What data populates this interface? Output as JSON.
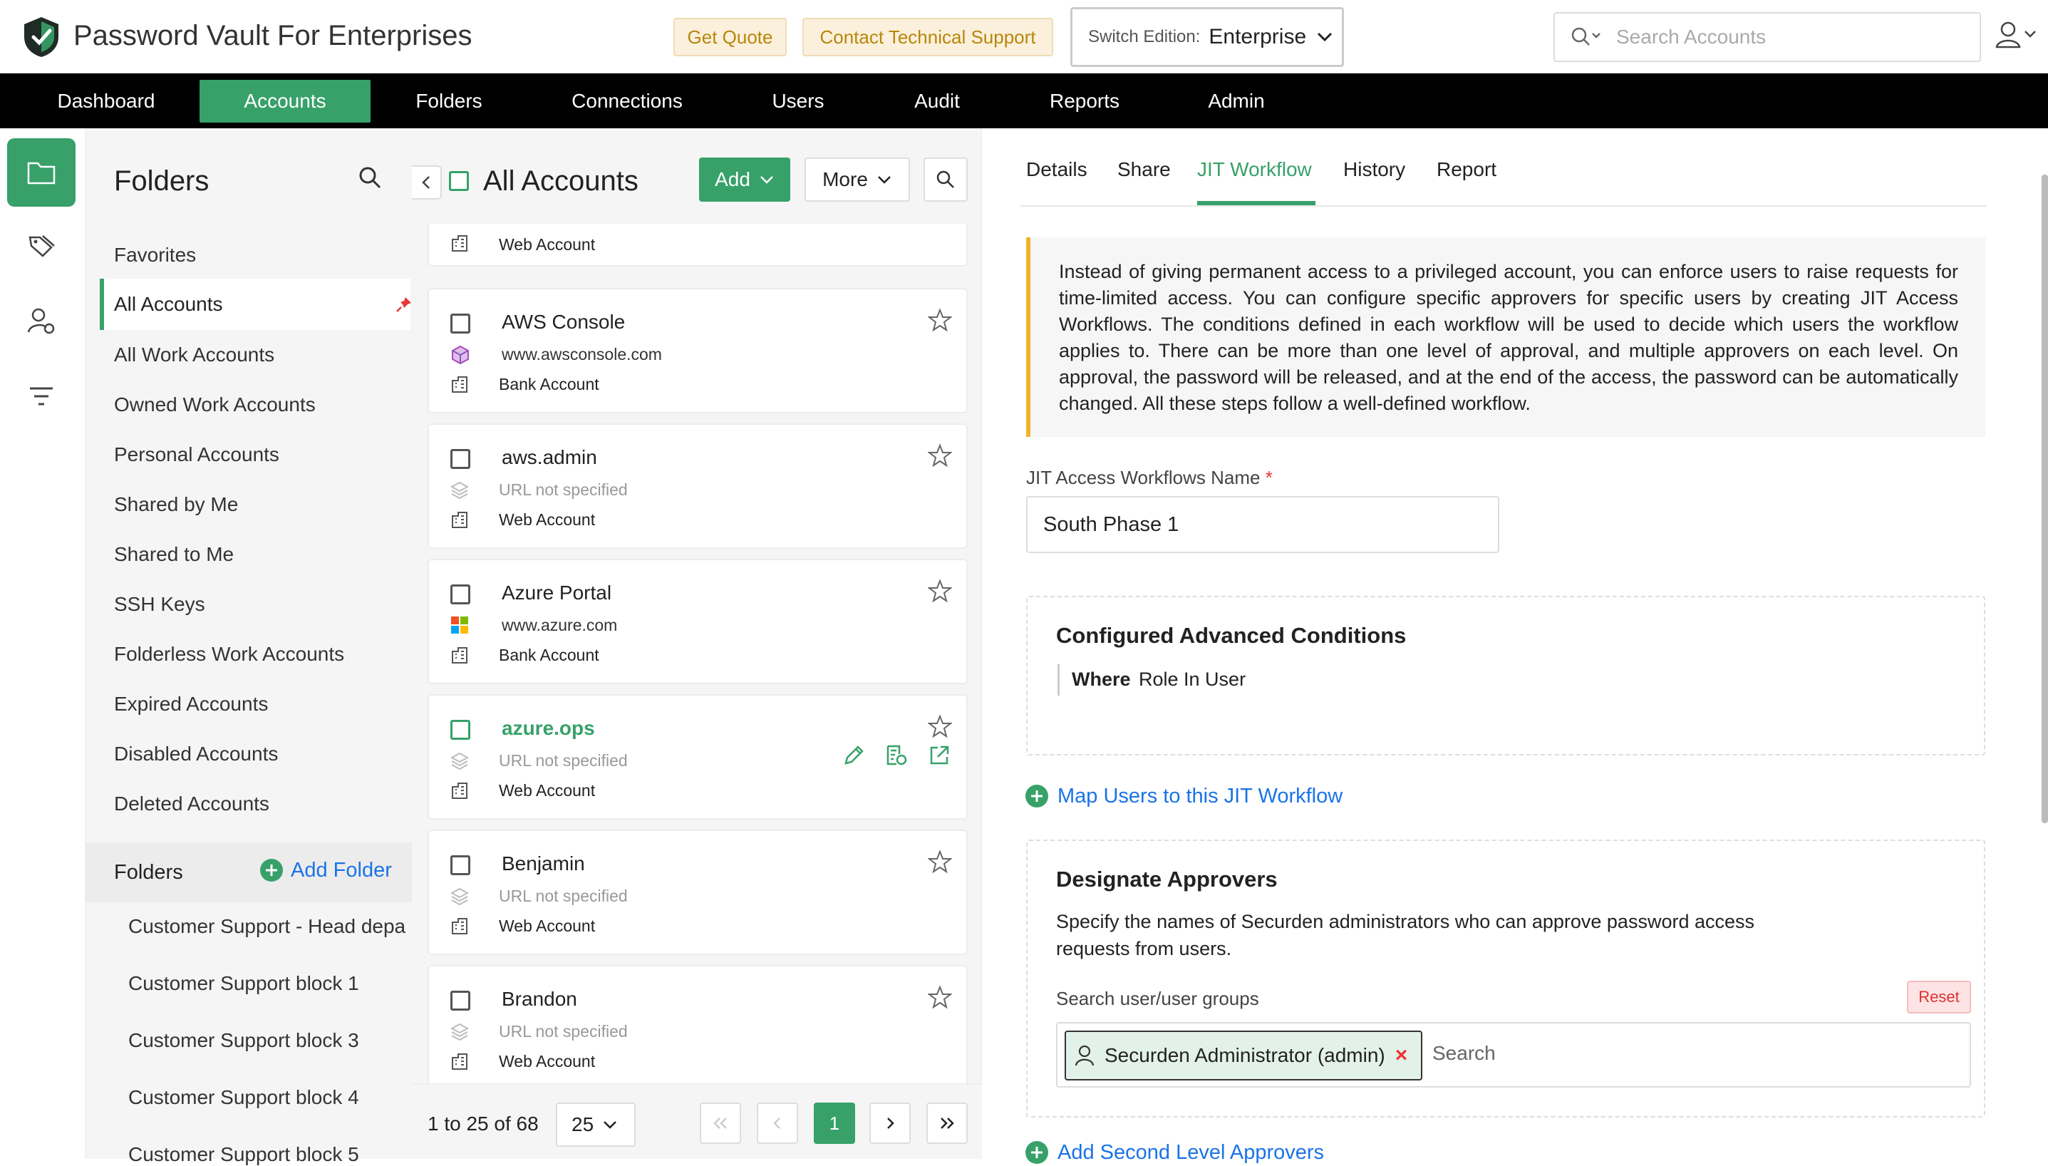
{
  "app": {
    "title": "Password Vault For Enterprises"
  },
  "header": {
    "get_quote": "Get Quote",
    "contact_support": "Contact Technical Support",
    "switch_label": "Switch Edition:",
    "switch_value": "Enterprise",
    "search_placeholder": "Search Accounts"
  },
  "nav": [
    "Dashboard",
    "Accounts",
    "Folders",
    "Connections",
    "Users",
    "Audit",
    "Reports",
    "Admin"
  ],
  "nav_active": "Accounts",
  "folders": {
    "title": "Folders",
    "items": [
      "Favorites",
      "All Accounts",
      "All Work Accounts",
      "Owned Work Accounts",
      "Personal Accounts",
      "Shared by Me",
      "Shared to Me",
      "SSH Keys",
      "Folderless Work Accounts",
      "Expired Accounts",
      "Disabled Accounts",
      "Deleted Accounts"
    ],
    "active": "All Accounts",
    "section_label": "Folders",
    "add_folder": "Add Folder",
    "sub_items": [
      "Customer Support - Head depa",
      "Customer Support block 1",
      "Customer Support block 3",
      "Customer Support block 4",
      "Customer Support block 5"
    ]
  },
  "accounts": {
    "title": "All Accounts",
    "add": "Add",
    "more": "More",
    "partial_type": "Web Account",
    "cards": [
      {
        "name": "AWS Console",
        "url": "www.awsconsole.com",
        "type": "Bank Account",
        "url_muted": false
      },
      {
        "name": "aws.admin",
        "url": "URL not specified",
        "type": "Web Account",
        "url_muted": true
      },
      {
        "name": "Azure Portal",
        "url": "www.azure.com",
        "type": "Bank Account",
        "url_muted": false
      },
      {
        "name": "azure.ops",
        "url": "URL not specified",
        "type": "Web Account",
        "url_muted": true
      },
      {
        "name": "Benjamin",
        "url": "URL not specified",
        "type": "Web Account",
        "url_muted": true
      },
      {
        "name": "Brandon",
        "url": "URL not specified",
        "type": "Web Account",
        "url_muted": true
      }
    ],
    "active_card": "azure.ops",
    "pagination": {
      "range": "1 to 25 of 68",
      "per_page": "25",
      "current_page": "1"
    }
  },
  "detail": {
    "tabs": [
      "Details",
      "Share",
      "JIT Workflow",
      "History",
      "Report"
    ],
    "active_tab": "JIT Workflow",
    "info": "Instead of giving permanent access to a privileged account, you can enforce users to raise requests for time-limited access. You can configure specific approvers for specific users by creating JIT Access Workflows. The conditions defined in each workflow will be used to decide which users the workflow applies to. There can be more than one level of approval, and multiple approvers on each level. On approval, the password will be released, and at the end of the access, the password can be automatically changed. All these steps follow a well-defined workflow.",
    "name_label": "JIT Access Workflows Name",
    "required_mark": "*",
    "name_value": "South Phase 1",
    "conditions_title": "Configured Advanced Conditions",
    "where_label": "Where",
    "where_rule": "Role In User",
    "map_users": "Map Users to this JIT Workflow",
    "approvers_title": "Designate Approvers",
    "approvers_desc": "Specify the names of Securden administrators who can approve password access requests from users.",
    "search_label": "Search user/user groups",
    "reset": "Reset",
    "chip": "Securden Administrator (admin)",
    "chip_remove": "×",
    "search_placeholder": "Search",
    "second_level": "Add Second Level Approvers"
  },
  "colors": {
    "accent": "#37a169",
    "link": "#1a73e8",
    "info_border": "#f0b429",
    "topbar_btn": "#fbf0dc"
  }
}
